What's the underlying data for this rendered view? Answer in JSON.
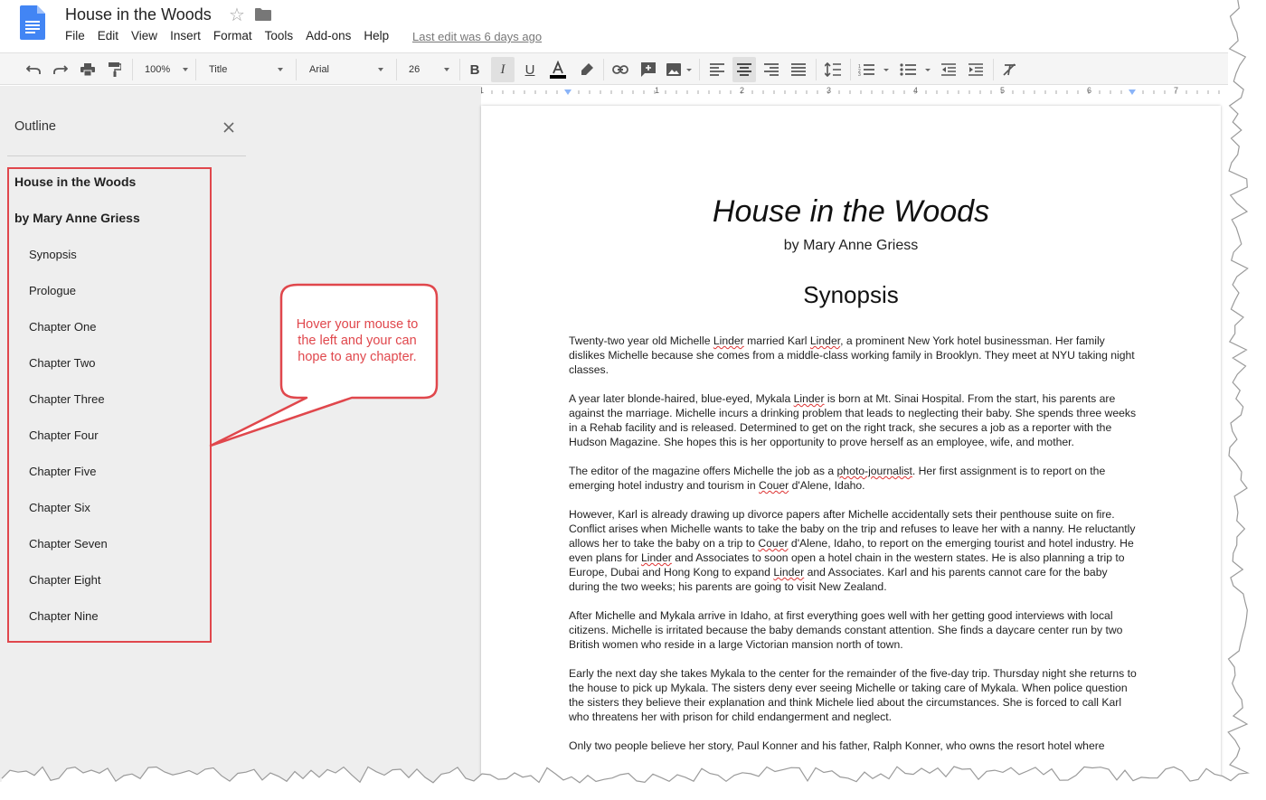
{
  "app": {
    "doc_title": "House in the Woods",
    "last_edit": "Last edit was 6 days ago",
    "menu": [
      "File",
      "Edit",
      "View",
      "Insert",
      "Format",
      "Tools",
      "Add-ons",
      "Help"
    ]
  },
  "toolbar": {
    "zoom": "100%",
    "style": "Title",
    "font": "Arial",
    "size": "26",
    "buttons": [
      "undo-icon",
      "redo-icon",
      "print-icon",
      "paint-format-icon",
      "bold-icon",
      "italic-icon",
      "underline-icon",
      "text-color-icon",
      "highlight-icon",
      "link-icon",
      "comment-icon",
      "image-icon",
      "align-left-icon",
      "align-center-icon",
      "align-right-icon",
      "justify-icon",
      "line-spacing-icon",
      "numbered-list-icon",
      "bulleted-list-icon",
      "decrease-indent-icon",
      "increase-indent-icon",
      "clear-formatting-icon"
    ],
    "text_color": "#000000"
  },
  "ruler": {
    "labels": [
      "1",
      "1",
      "2",
      "3",
      "4",
      "5",
      "6",
      "7"
    ]
  },
  "outline": {
    "title": "Outline",
    "items": [
      {
        "label": "House in the Woods",
        "level": 1
      },
      {
        "label": "by Mary Anne Griess",
        "level": 1
      },
      {
        "label": "Synopsis",
        "level": 2
      },
      {
        "label": "Prologue",
        "level": 2
      },
      {
        "label": "Chapter One",
        "level": 2
      },
      {
        "label": "Chapter Two",
        "level": 2
      },
      {
        "label": "Chapter Three",
        "level": 2
      },
      {
        "label": "Chapter Four",
        "level": 2
      },
      {
        "label": "Chapter Five",
        "level": 2
      },
      {
        "label": "Chapter Six",
        "level": 2
      },
      {
        "label": "Chapter Seven",
        "level": 2
      },
      {
        "label": "Chapter Eight",
        "level": 2
      },
      {
        "label": "Chapter Nine",
        "level": 2
      }
    ]
  },
  "callout": {
    "text": "Hover your mouse to the left and your can hope to any chapter.",
    "color": "#e0474c"
  },
  "document": {
    "title": "House in the Woods",
    "author": "by Mary Anne Griess",
    "heading": "Synopsis",
    "paragraphs": [
      "Twenty-two year old Michelle Linder married Karl Linder, a prominent New York hotel businessman.  Her family dislikes Michelle because she comes from a middle-class working family in Brooklyn.  They meet at NYU taking night classes.",
      "A year later blonde-haired, blue-eyed, Mykala Linder is born at Mt. Sinai Hospital.  From the start, his parents are against the marriage.  Michelle incurs a drinking problem that leads to neglecting their baby.  She spends three weeks in a Rehab facility and is released.  Determined to get on the right track, she secures a job as a reporter with the Hudson Magazine.  She hopes this is her opportunity to prove herself as an employee, wife, and mother.",
      "The editor of the magazine offers Michelle the job as a photo-journalist.  Her first assignment is to report on the emerging hotel industry and tourism in Couer d'Alene, Idaho.",
      "However, Karl is already drawing up divorce papers after Michelle accidentally sets their penthouse suite on fire. Conflict arises when Michelle wants to take the baby on the trip and refuses to leave her with a nanny.  He reluctantly allows her to take the baby on a trip to Couer d'Alene, Idaho, to report on the emerging tourist and hotel industry.  He even plans for Linder and Associates to soon open a hotel chain in the western states.  He is also planning a trip to Europe, Dubai and Hong Kong to expand Linder and Associates.  Karl and his parents cannot care for the baby during the two weeks; his parents are going to visit New Zealand.",
      "After Michelle and Mykala arrive in Idaho, at first everything goes well with her getting good interviews with local citizens.  Michelle is irritated because the baby demands constant attention.  She finds a daycare center run by two British women who reside in a large Victorian mansion north of town.",
      "Early the next day she takes Mykala to the center for the remainder of the five-day trip.  Thursday night she returns to the house to pick up Mykala.  The sisters deny ever seeing Michelle or taking care of Mykala.  When police question the sisters they believe their explanation and think Michele lied about the circumstances.  She is forced to call Karl who threatens her with prison for child endangerment and neglect.",
      "Only two people believe her story, Paul Konner and his father, Ralph Konner, who owns the resort hotel where"
    ]
  }
}
